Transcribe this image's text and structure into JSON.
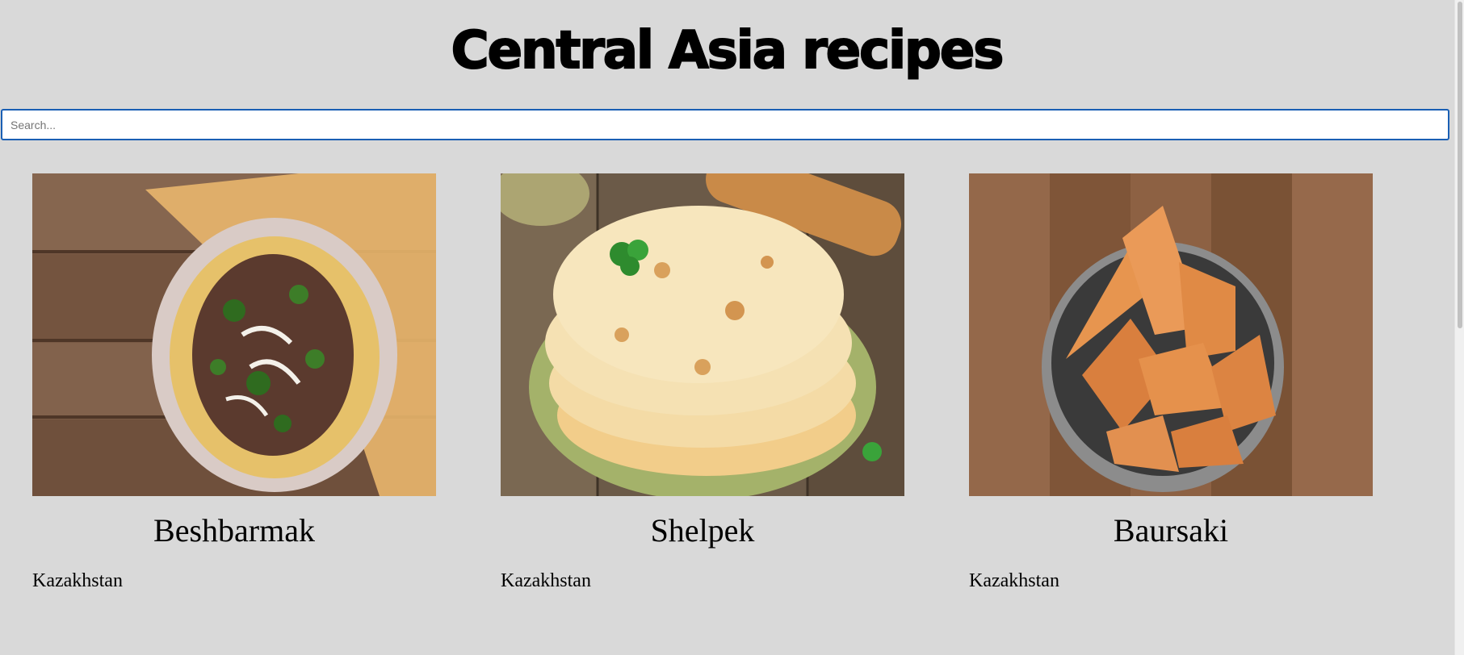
{
  "header": {
    "title": "Central Asia recipes"
  },
  "search": {
    "placeholder": "Search...",
    "value": ""
  },
  "recipes": [
    {
      "name": "Beshbarmak",
      "country": "Kazakhstan",
      "image_icon": "beshbarmak-dish-image"
    },
    {
      "name": "Shelpek",
      "country": "Kazakhstan",
      "image_icon": "shelpek-flatbread-image"
    },
    {
      "name": "Baursaki",
      "country": "Kazakhstan",
      "image_icon": "baursaki-fried-dough-image"
    }
  ],
  "colors": {
    "background": "#d9d9d9",
    "search_border": "#1a5fb4",
    "text": "#000000"
  }
}
